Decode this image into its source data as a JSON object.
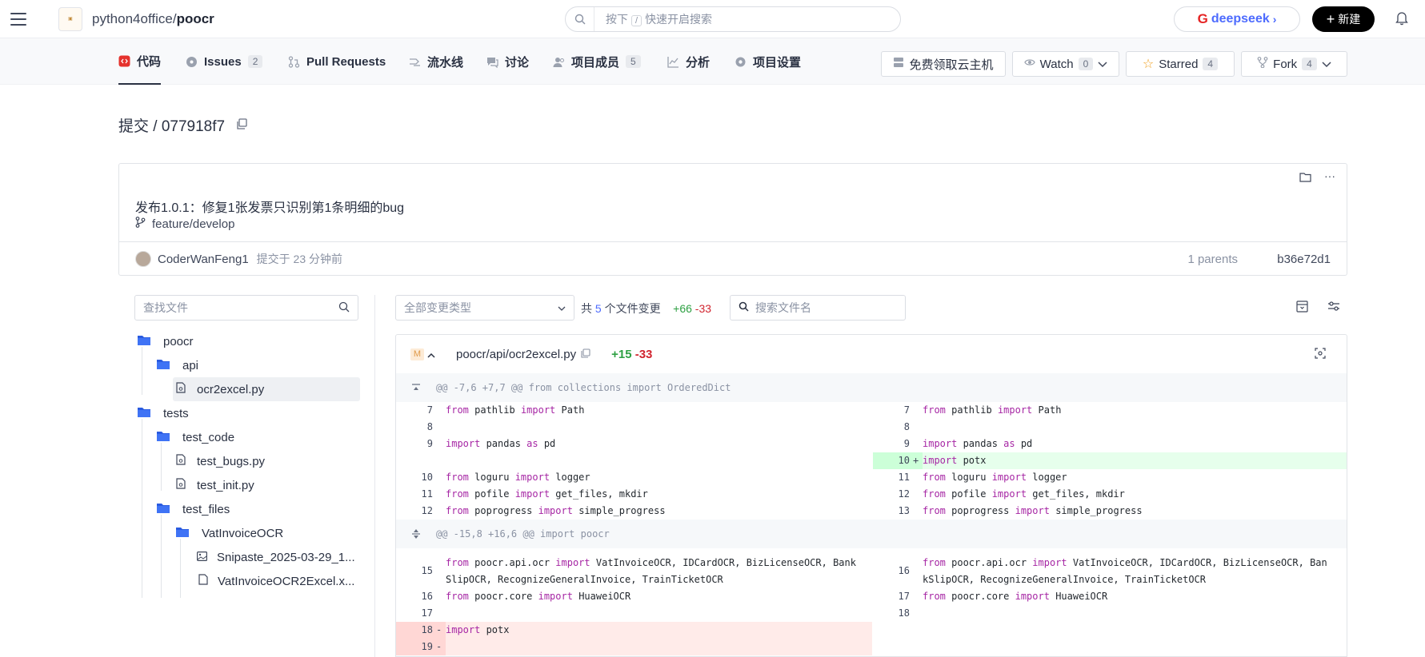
{
  "header": {
    "org": "python4office",
    "sep": "/",
    "repo": "poocr",
    "search_placeholder_pre": "按下",
    "search_key": "/",
    "search_placeholder_post": "快速开启搜索",
    "deepseek_label": "deepseek",
    "deepseek_arrow": "›",
    "new_label": "新建"
  },
  "nav": {
    "tabs": [
      {
        "label": "代码"
      },
      {
        "label": "Issues",
        "count": "2"
      },
      {
        "label": "Pull Requests"
      },
      {
        "label": "流水线"
      },
      {
        "label": "讨论"
      },
      {
        "label": "项目成员",
        "count": "5"
      },
      {
        "label": "分析"
      },
      {
        "label": "项目设置"
      }
    ],
    "cloud": "免费领取云主机",
    "watch": "Watch",
    "watch_count": "0",
    "starred": "Starred",
    "star_count": "4",
    "fork": "Fork",
    "fork_count": "4"
  },
  "commit": {
    "title": "提交 / 077918f7",
    "message": "发布1.0.1：修复1张发票只识别第1条明细的bug",
    "branch": "feature/develop",
    "author": "CoderWanFeng1",
    "time": "提交于 23 分钟前",
    "parents": "1 parents",
    "parent_sha": "b36e72d1"
  },
  "tree": {
    "search_placeholder": "查找文件",
    "items": [
      {
        "label": "poocr",
        "type": "folder"
      },
      {
        "label": "api",
        "type": "folder"
      },
      {
        "label": "ocr2excel.py",
        "type": "file"
      },
      {
        "label": "tests",
        "type": "folder"
      },
      {
        "label": "test_code",
        "type": "folder"
      },
      {
        "label": "test_bugs.py",
        "type": "file"
      },
      {
        "label": "test_init.py",
        "type": "file"
      },
      {
        "label": "test_files",
        "type": "folder"
      },
      {
        "label": "VatInvoiceOCR",
        "type": "folder"
      },
      {
        "label": "Snipaste_2025-03-29_1...",
        "type": "image"
      },
      {
        "label": "VatInvoiceOCR2Excel.x...",
        "type": "file"
      }
    ]
  },
  "diff": {
    "type_placeholder": "全部变更类型",
    "summary_pre": "共",
    "summary_num": "5",
    "summary_post": "个文件变更",
    "additions": "+66",
    "deletions": "-33",
    "file_search_placeholder": "搜索文件名",
    "file": {
      "status": "M",
      "path": "poocr/api/ocr2excel.py",
      "additions": "+15",
      "deletions": "-33"
    },
    "hunk1": "@@ -7,6 +7,7 @@ from collections import OrderedDict",
    "hunk2": "@@ -15,8 +16,6 @@ import poocr"
  }
}
